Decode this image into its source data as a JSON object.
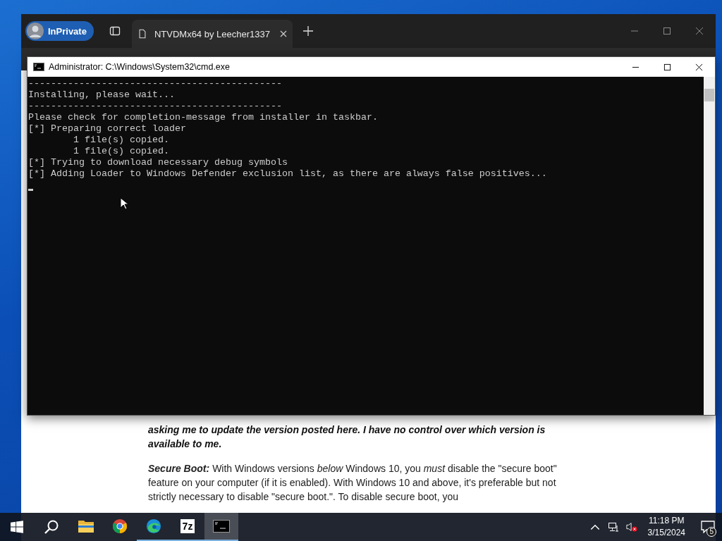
{
  "browser": {
    "inprivate_label": "InPrivate",
    "tabs": [
      {
        "title": "NTVDMx64 by Leecher1337",
        "selected": true
      }
    ]
  },
  "article": {
    "paragraphs": [
      {
        "kind": "emphasis",
        "text": "asking me to update the version posted here. I have no control over which version is available to me."
      },
      {
        "kind": "normal",
        "lead": "Secure Boot:",
        "text": "With Windows versions *below* Windows 10, you *must* disable the \"secure boot\" feature on your computer (if it is enabled). With Windows 10 and above, it's preferable but not strictly necessary to disable \"secure boot.\". To disable secure boot, you"
      }
    ]
  },
  "console": {
    "title": "Administrator: C:\\Windows\\System32\\cmd.exe",
    "lines": [
      "---------------------------------------------",
      "Installing, please wait...",
      "---------------------------------------------",
      "Please check for completion-message from installer in taskbar.",
      "[*] Preparing correct loader",
      "        1 file(s) copied.",
      "        1 file(s) copied.",
      "[*] Trying to download necessary debug symbols",
      "[*] Adding Loader to Windows Defender exclusion list, as there are always false positives..."
    ],
    "cursor": true
  },
  "taskbar": {
    "apps": [
      {
        "kind": "folder",
        "running": false,
        "selected": false
      },
      {
        "kind": "chrome",
        "running": false,
        "selected": false
      },
      {
        "kind": "edge",
        "running": true,
        "selected": false
      },
      {
        "kind": "sevenzip",
        "label": "7z",
        "running": true,
        "selected": false
      },
      {
        "kind": "console",
        "running": true,
        "selected": true
      }
    ],
    "volume_muted": true,
    "clock": {
      "time": "11:18 PM",
      "date": "3/15/2024"
    },
    "notifications": "5"
  }
}
